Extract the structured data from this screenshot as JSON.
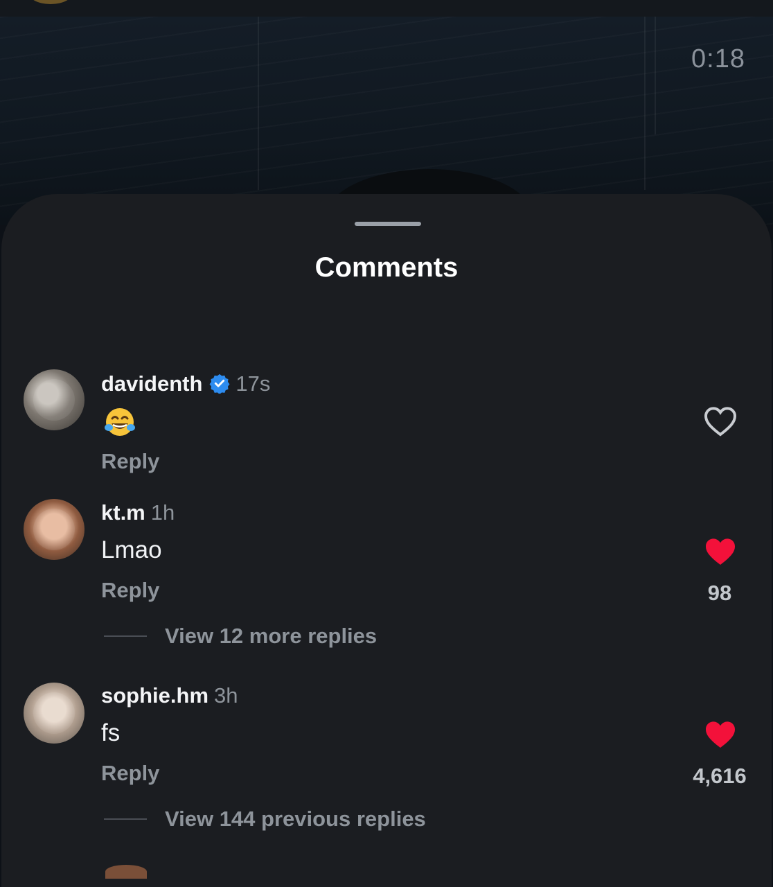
{
  "video": {
    "timestamp": "0:18"
  },
  "sheet": {
    "title": "Comments"
  },
  "comments": [
    {
      "username": "davidenth",
      "verified": true,
      "age": "17s",
      "text": "😂",
      "reply_label": "Reply",
      "liked": false,
      "likes": ""
    },
    {
      "username": "kt.m",
      "verified": false,
      "age": "1h",
      "text": "Lmao",
      "reply_label": "Reply",
      "liked": true,
      "likes": "98",
      "thread_label": "View 12 more replies"
    },
    {
      "username": "sophie.hm",
      "verified": false,
      "age": "3h",
      "text": "fs",
      "reply_label": "Reply",
      "liked": true,
      "likes": "4,616",
      "thread_label": "View 144 previous replies"
    }
  ],
  "colors": {
    "like_active": "#f3113a",
    "verified": "#2d8cf0",
    "sheet_bg": "#1b1d21"
  },
  "icons": {
    "like": "heart-icon",
    "verified": "verified-badge-icon",
    "handle": "drag-handle"
  }
}
